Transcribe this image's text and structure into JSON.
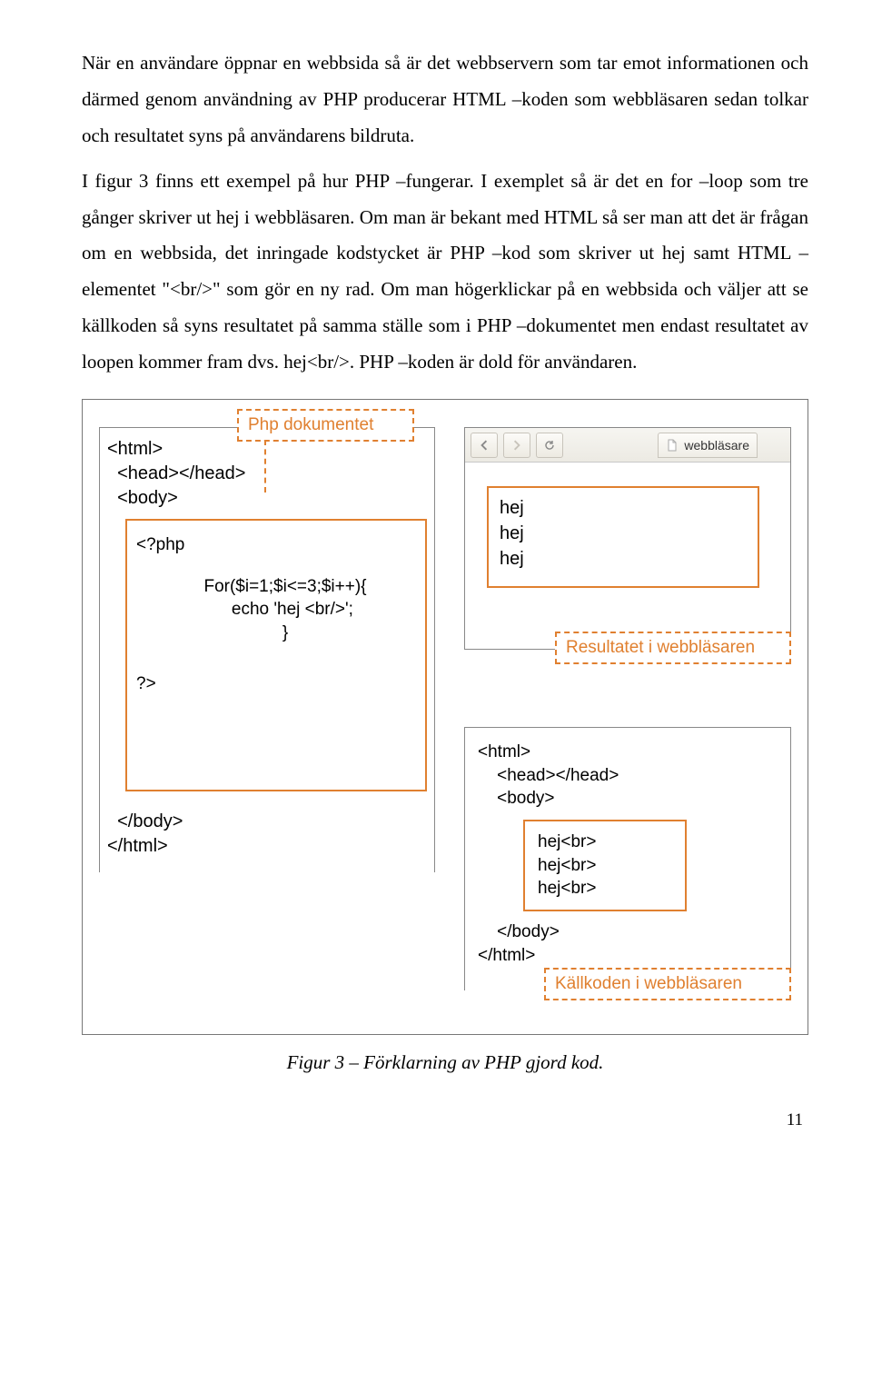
{
  "paragraph1": "När en användare öppnar en webbsida så är det webbservern som tar emot informationen och därmed genom användning av PHP producerar HTML –koden som webbläsaren sedan tolkar och resultatet syns på användarens bildruta.",
  "paragraph2": "I figur 3 finns ett exempel på hur PHP –fungerar. I exemplet så är det en for –loop som tre gånger skriver ut hej i webbläsaren. Om man är bekant med HTML så ser man att det är frågan om en webbsida, det inringade kodstycket är PHP –kod som skriver ut hej samt HTML –elementet \"<br/>\" som gör en ny rad. Om man högerklickar på en webbsida och väljer att se källkoden så syns resultatet på samma ställe som i PHP –dokumentet men endast resultatet av loopen kommer fram dvs. hej<br/>. PHP –koden är dold för användaren.",
  "labels": {
    "php_doc": "Php dokumentet",
    "result": "Resultatet i webbläsaren",
    "source": "Källkoden i webbläsaren"
  },
  "left_panel": {
    "top_lines": "<html>\n  <head></head>\n  <body>",
    "bottom_lines": "  </body>\n</html>",
    "php_open": "<?php",
    "php_body": "For($i=1;$i<=3;$i++){\n   echo 'hej <br/>';\n}",
    "php_close": "?>"
  },
  "browser": {
    "tab_title": "webbläsare",
    "output": "hej\nhej\nhej"
  },
  "source_panel": {
    "top": "<html>\n    <head></head>\n    <body>",
    "hej": "hej<br>\nhej<br>\nhej<br>",
    "bottom": "    </body>\n</html>"
  },
  "caption": "Figur 3 – Förklarning av PHP gjord kod.",
  "page_number": "11"
}
